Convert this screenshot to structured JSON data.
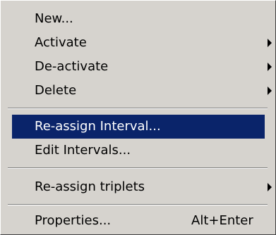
{
  "menu": {
    "items": [
      {
        "label": "New...",
        "shortcut": "",
        "has_submenu": false,
        "highlighted": false
      },
      {
        "label": "Activate",
        "shortcut": "",
        "has_submenu": true,
        "highlighted": false
      },
      {
        "label": "De-activate",
        "shortcut": "",
        "has_submenu": true,
        "highlighted": false
      },
      {
        "label": "Delete",
        "shortcut": "",
        "has_submenu": true,
        "highlighted": false
      },
      {
        "label": "Re-assign Interval...",
        "shortcut": "",
        "has_submenu": false,
        "highlighted": true
      },
      {
        "label": "Edit Intervals...",
        "shortcut": "",
        "has_submenu": false,
        "highlighted": false
      },
      {
        "label": "Re-assign triplets",
        "shortcut": "",
        "has_submenu": true,
        "highlighted": false
      },
      {
        "label": "Properties...",
        "shortcut": "Alt+Enter",
        "has_submenu": false,
        "highlighted": false
      }
    ]
  },
  "colors": {
    "menu_background": "#d6d3ce",
    "highlight_background": "#0a246a",
    "highlight_text": "#ffffff",
    "text": "#000000"
  },
  "icons": {
    "submenu_arrow": "submenu-arrow-icon"
  }
}
